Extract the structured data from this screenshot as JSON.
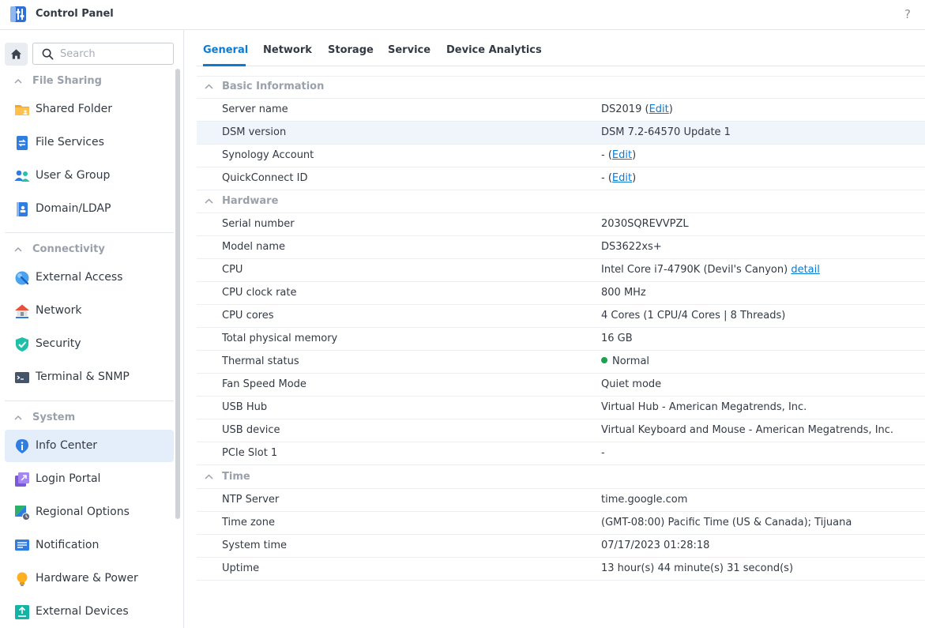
{
  "window": {
    "title": "Control Panel",
    "help": "?"
  },
  "colors": {
    "accent": "#0a7bd6",
    "status_ok": "#1aa34a",
    "active_bg": "#e4eefb"
  },
  "search": {
    "placeholder": "Search"
  },
  "sidebar": {
    "groups": [
      {
        "label": "File Sharing",
        "items": [
          {
            "label": "Shared Folder",
            "icon": "folder-icon"
          },
          {
            "label": "File Services",
            "icon": "file-services-icon"
          },
          {
            "label": "User & Group",
            "icon": "users-icon"
          },
          {
            "label": "Domain/LDAP",
            "icon": "directory-icon"
          }
        ]
      },
      {
        "label": "Connectivity",
        "items": [
          {
            "label": "External Access",
            "icon": "globe-icon"
          },
          {
            "label": "Network",
            "icon": "house-network-icon"
          },
          {
            "label": "Security",
            "icon": "shield-icon"
          },
          {
            "label": "Terminal & SNMP",
            "icon": "terminal-icon"
          }
        ]
      },
      {
        "label": "System",
        "items": [
          {
            "label": "Info Center",
            "icon": "info-icon",
            "active": true
          },
          {
            "label": "Login Portal",
            "icon": "portal-icon"
          },
          {
            "label": "Regional Options",
            "icon": "regional-icon"
          },
          {
            "label": "Notification",
            "icon": "notification-icon"
          },
          {
            "label": "Hardware & Power",
            "icon": "lightbulb-icon"
          },
          {
            "label": "External Devices",
            "icon": "external-device-icon"
          }
        ]
      }
    ]
  },
  "tabs": [
    {
      "label": "General",
      "active": true
    },
    {
      "label": "Network"
    },
    {
      "label": "Storage"
    },
    {
      "label": "Service"
    },
    {
      "label": "Device Analytics"
    }
  ],
  "basic": {
    "title": "Basic Information",
    "server_name_label": "Server name",
    "server_name": "DS2019",
    "edit": "Edit",
    "dsm_label": "DSM version",
    "dsm": "DSM 7.2-64570 Update 1",
    "account_label": "Synology Account",
    "account": "-",
    "quickconnect_label": "QuickConnect ID",
    "quickconnect": "-"
  },
  "hardware": {
    "title": "Hardware",
    "serial_label": "Serial number",
    "serial": "2030SQREVVPZL",
    "model_label": "Model name",
    "model": "DS3622xs+",
    "cpu_label": "CPU",
    "cpu": "Intel Core i7-4790K (Devil's Canyon)",
    "cpu_detail": "detail",
    "clock_label": "CPU clock rate",
    "clock": "800 MHz",
    "cores_label": "CPU cores",
    "cores": "4 Cores (1 CPU/4 Cores | 8 Threads)",
    "memory_label": "Total physical memory",
    "memory": "16 GB",
    "thermal_label": "Thermal status",
    "thermal": "Normal",
    "fan_label": "Fan Speed Mode",
    "fan": "Quiet mode",
    "usb_hub_label": "USB Hub",
    "usb_hub": "Virtual Hub - American Megatrends, Inc.",
    "usb_device_label": "USB device",
    "usb_device": "Virtual Keyboard and Mouse - American Megatrends, Inc.",
    "pcie_label": "PCIe Slot 1",
    "pcie": "-"
  },
  "time": {
    "title": "Time",
    "ntp_label": "NTP Server",
    "ntp": "time.google.com",
    "zone_label": "Time zone",
    "zone": "(GMT-08:00) Pacific Time (US & Canada); Tijuana",
    "system_label": "System time",
    "system": "07/17/2023 01:28:18",
    "uptime_label": "Uptime",
    "uptime": "13 hour(s) 44 minute(s) 31 second(s)"
  }
}
